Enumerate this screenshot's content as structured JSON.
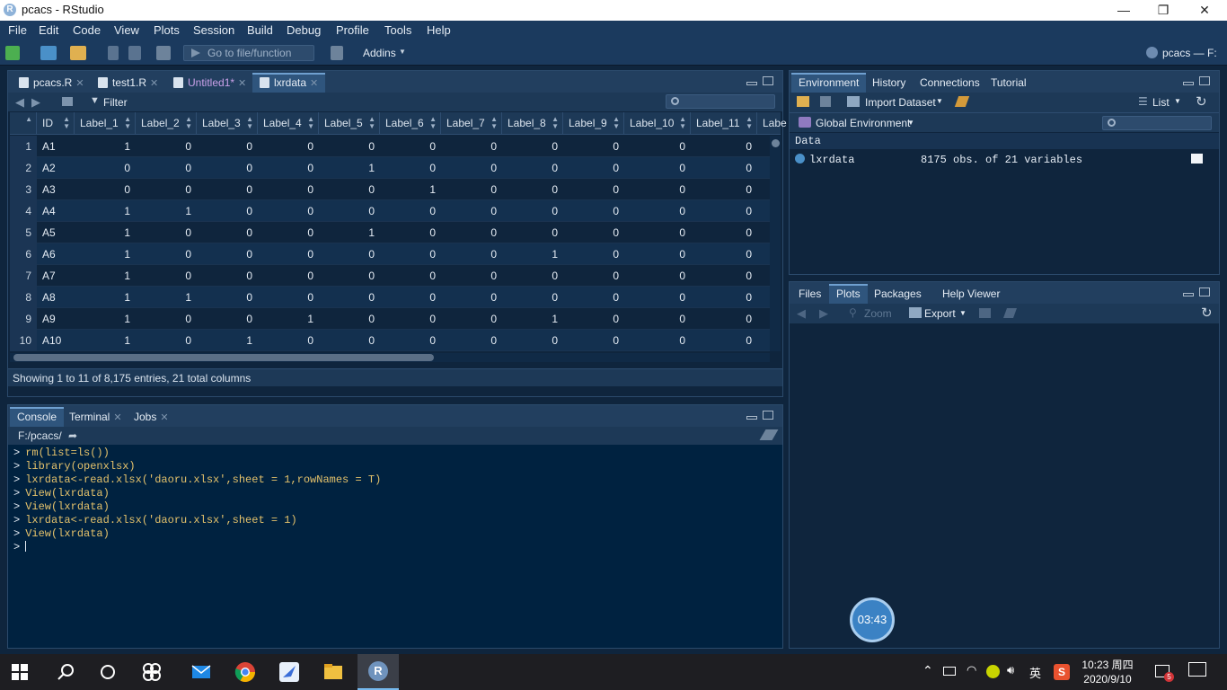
{
  "window": {
    "title": "pcacs - RStudio",
    "min": "—",
    "max": "❐",
    "close": "✕"
  },
  "menu": [
    "File",
    "Edit",
    "Code",
    "View",
    "Plots",
    "Session",
    "Build",
    "Debug",
    "Profile",
    "Tools",
    "Help"
  ],
  "toolbar": {
    "goto_placeholder": "Go to file/function",
    "addins": "Addins",
    "project": "pcacs — F:"
  },
  "source_tabs": [
    {
      "label": "pcacs.R"
    },
    {
      "label": "test1.R"
    },
    {
      "label": "Untitled1*"
    },
    {
      "label": "lxrdata"
    }
  ],
  "viewer": {
    "filter": "Filter",
    "columns": [
      "ID",
      "Label_1",
      "Label_2",
      "Label_3",
      "Label_4",
      "Label_5",
      "Label_6",
      "Label_7",
      "Label_8",
      "Label_9",
      "Label_10",
      "Label_11",
      "Labe"
    ],
    "rows": [
      [
        "1",
        "A1",
        "1",
        "0",
        "0",
        "0",
        "0",
        "0",
        "0",
        "0",
        "0",
        "0",
        "0"
      ],
      [
        "2",
        "A2",
        "0",
        "0",
        "0",
        "0",
        "1",
        "0",
        "0",
        "0",
        "0",
        "0",
        "0"
      ],
      [
        "3",
        "A3",
        "0",
        "0",
        "0",
        "0",
        "0",
        "1",
        "0",
        "0",
        "0",
        "0",
        "0"
      ],
      [
        "4",
        "A4",
        "1",
        "1",
        "0",
        "0",
        "0",
        "0",
        "0",
        "0",
        "0",
        "0",
        "0"
      ],
      [
        "5",
        "A5",
        "1",
        "0",
        "0",
        "0",
        "1",
        "0",
        "0",
        "0",
        "0",
        "0",
        "0"
      ],
      [
        "6",
        "A6",
        "1",
        "0",
        "0",
        "0",
        "0",
        "0",
        "0",
        "1",
        "0",
        "0",
        "0"
      ],
      [
        "7",
        "A7",
        "1",
        "0",
        "0",
        "0",
        "0",
        "0",
        "0",
        "0",
        "0",
        "0",
        "0"
      ],
      [
        "8",
        "A8",
        "1",
        "1",
        "0",
        "0",
        "0",
        "0",
        "0",
        "0",
        "0",
        "0",
        "0"
      ],
      [
        "9",
        "A9",
        "1",
        "0",
        "0",
        "1",
        "0",
        "0",
        "0",
        "1",
        "0",
        "0",
        "0"
      ],
      [
        "10",
        "A10",
        "1",
        "0",
        "1",
        "0",
        "0",
        "0",
        "0",
        "0",
        "0",
        "0",
        "0"
      ]
    ],
    "status": "Showing 1 to 11 of 8,175 entries, 21 total columns"
  },
  "console_tabs": [
    {
      "label": "Console"
    },
    {
      "label": "Terminal"
    },
    {
      "label": "Jobs"
    }
  ],
  "console": {
    "path": "F:/pcacs/",
    "prompt": ">",
    "lines": [
      "rm(list=ls())",
      "library(openxlsx)",
      "lxrdata<-read.xlsx('daoru.xlsx',sheet = 1,rowNames = T)",
      "View(lxrdata)",
      "View(lxrdata)",
      "lxrdata<-read.xlsx('daoru.xlsx',sheet = 1)",
      "View(lxrdata)"
    ]
  },
  "env_tabs": [
    "Environment",
    "History",
    "Connections",
    "Tutorial"
  ],
  "env": {
    "import": "Import Dataset",
    "list": "List",
    "scope": "Global Environment",
    "section": "Data",
    "var_name": "lxrdata",
    "var_desc": "8175 obs. of 21 variables"
  },
  "files_tabs": [
    "Files",
    "Plots",
    "Packages",
    "Help",
    "Viewer"
  ],
  "plots": {
    "zoom": "Zoom",
    "export": "Export"
  },
  "timer": "03:43",
  "taskbar": {
    "time": "10:23 周四",
    "date": "2020/9/10",
    "ime": "英",
    "notif": "5"
  }
}
